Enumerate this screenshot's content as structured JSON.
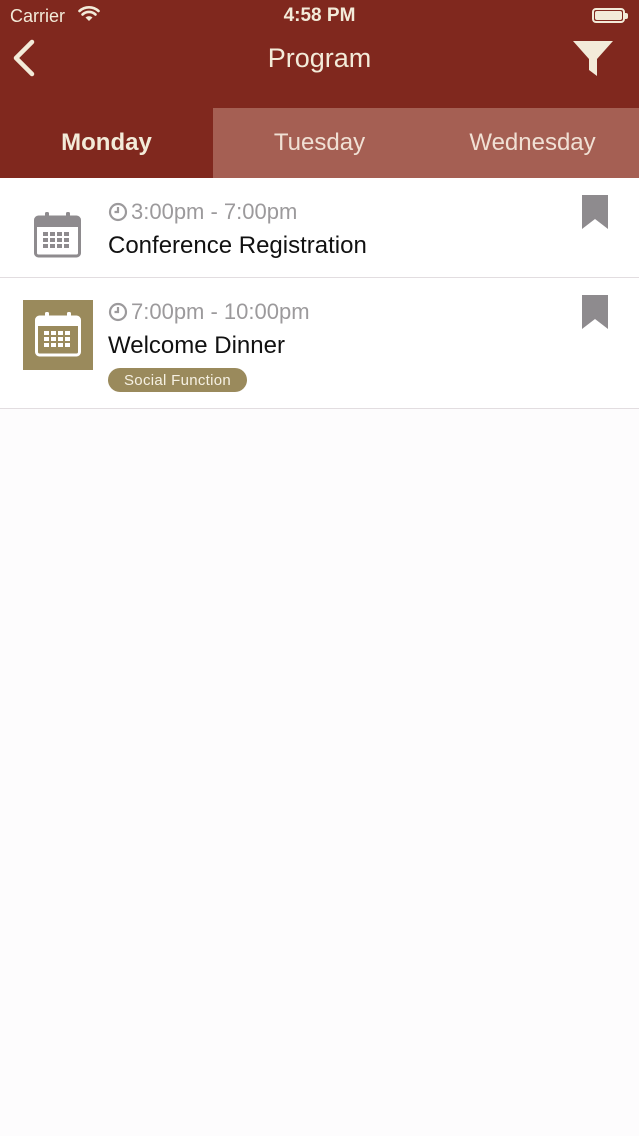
{
  "status_bar": {
    "carrier": "Carrier",
    "time": "4:58 PM"
  },
  "nav": {
    "title": "Program",
    "back_icon": "chevron-left-icon",
    "filter_icon": "filter-icon"
  },
  "tabs": [
    {
      "label": "Monday",
      "active": true
    },
    {
      "label": "Tuesday",
      "active": false
    },
    {
      "label": "Wednesday",
      "active": false
    }
  ],
  "events": [
    {
      "time": "3:00pm - 7:00pm",
      "title": "Conference Registration",
      "tag": ""
    },
    {
      "time": "7:00pm - 10:00pm",
      "title": "Welcome Dinner",
      "tag": "Social Function"
    }
  ],
  "colors": {
    "header": "#80281e",
    "tab_inactive": "#a55f53",
    "header_text": "#f3ebd9",
    "accent_gold": "#9a8a5c",
    "icon_gray": "#8e8b8e"
  }
}
